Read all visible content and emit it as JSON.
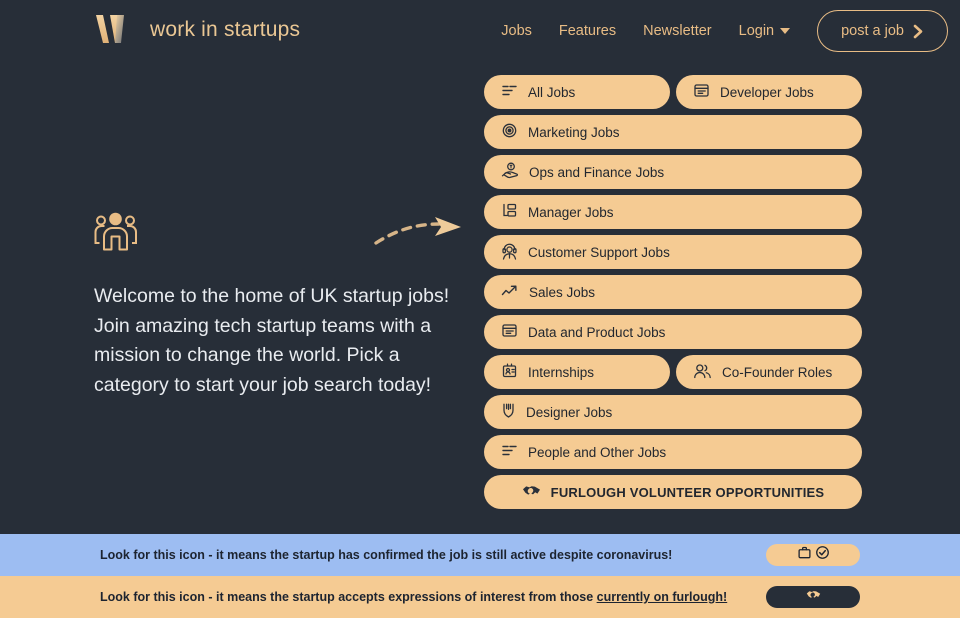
{
  "theme": {
    "background": "#272e38",
    "accent": "#e8bc85",
    "button_fill": "#f5cb93",
    "banner_blue": "#9dbdf2",
    "banner_tan": "#f5cb93",
    "text_light": "#e9ecf0",
    "text_dark": "#22272f"
  },
  "header": {
    "logo_icon": "w-logo-icon",
    "brand_name": "work in startups",
    "nav": [
      {
        "label": "Jobs",
        "name": "jobs"
      },
      {
        "label": "Features",
        "name": "features"
      },
      {
        "label": "Newsletter",
        "name": "newsletter"
      },
      {
        "label": "Login",
        "name": "login",
        "has_caret": true
      }
    ],
    "cta": {
      "label": "post a job",
      "icon": "chevron-right-icon"
    }
  },
  "left_panel": {
    "icon": "three-people-icon",
    "arrow_icon": "curved-dashed-arrow-icon",
    "welcome_text": "Welcome to the home of UK startup jobs! Join amazing tech startup teams with a mission to change the world. Pick a category to start your job search today!"
  },
  "categories": {
    "rows": [
      {
        "items": [
          {
            "label": "All Jobs",
            "icon": "list-lines-icon",
            "half": true
          },
          {
            "label": "Developer Jobs",
            "icon": "browser-window-icon",
            "half": true
          }
        ]
      },
      {
        "items": [
          {
            "label": "Marketing Jobs",
            "icon": "target-icon",
            "half": false
          }
        ]
      },
      {
        "items": [
          {
            "label": "Ops and Finance Jobs",
            "icon": "hand-coin-icon",
            "half": false
          }
        ]
      },
      {
        "items": [
          {
            "label": "Manager Jobs",
            "icon": "org-chart-icon",
            "half": false
          }
        ]
      },
      {
        "items": [
          {
            "label": "Customer Support Jobs",
            "icon": "headset-agent-icon",
            "half": false
          }
        ]
      },
      {
        "items": [
          {
            "label": "Sales Jobs",
            "icon": "trending-up-arrow-icon",
            "half": false
          }
        ]
      },
      {
        "items": [
          {
            "label": "Data and Product Jobs",
            "icon": "browser-window-icon",
            "half": false
          }
        ]
      },
      {
        "items": [
          {
            "label": "Internships",
            "icon": "id-badge-icon",
            "half": true
          },
          {
            "label": "Co-Founder Roles",
            "icon": "two-people-icon",
            "half": true
          }
        ]
      },
      {
        "items": [
          {
            "label": "Designer Jobs",
            "icon": "pen-nib-icon",
            "half": false
          }
        ]
      },
      {
        "items": [
          {
            "label": "People and Other Jobs",
            "icon": "list-lines-icon",
            "half": false
          }
        ]
      },
      {
        "items": [
          {
            "label": "FURLOUGH VOLUNTEER OPPORTUNITIES",
            "icon": "handshake-icon",
            "half": false,
            "center": true
          }
        ]
      }
    ]
  },
  "banners": [
    {
      "name": "coronavirus-active-job-banner",
      "text": "Look for this icon - it means the startup has confirmed the job is still active despite coronavirus!",
      "badge_icons": [
        "briefcase-icon",
        "check-circle-icon"
      ],
      "badge_style": "tan"
    },
    {
      "name": "furlough-banner",
      "text_before": "Look for this icon - it means the startup accepts expressions of interest from those ",
      "text_link": "currently on furlough!",
      "badge_icons": [
        "handshake-icon"
      ],
      "badge_style": "dark"
    }
  ]
}
